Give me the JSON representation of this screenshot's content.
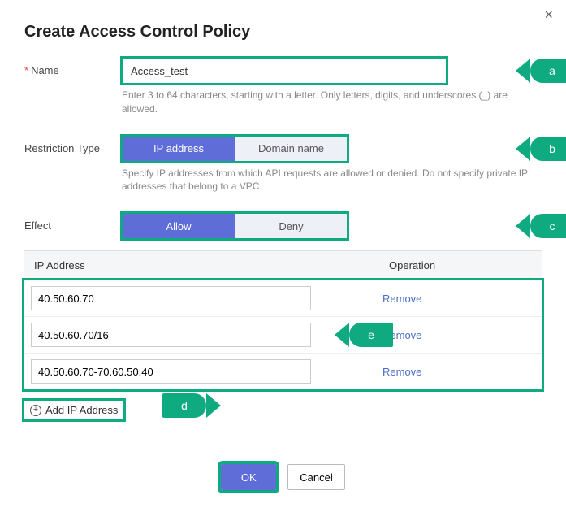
{
  "close_icon": "×",
  "title": "Create Access Control Policy",
  "name": {
    "label": "Name",
    "required": "*",
    "value": "Access_test",
    "hint": "Enter 3 to 64 characters, starting with a letter. Only letters, digits, and underscores (_) are allowed."
  },
  "restriction": {
    "label": "Restriction Type",
    "options": [
      "IP address",
      "Domain name"
    ],
    "selected_index": 0,
    "hint": "Specify IP addresses from which API requests are allowed or denied. Do not specify private IP addresses that belong to a VPC."
  },
  "effect": {
    "label": "Effect",
    "options": [
      "Allow",
      "Deny"
    ],
    "selected_index": 0
  },
  "table": {
    "headers": {
      "ip": "IP Address",
      "op": "Operation"
    },
    "rows": [
      {
        "value": "40.50.60.70",
        "op": "Remove"
      },
      {
        "value": "40.50.60.70/16",
        "op": "Remove"
      },
      {
        "value": "40.50.60.70-70.60.50.40",
        "op": "Remove"
      }
    ],
    "add_label": "Add IP Address"
  },
  "callouts": {
    "a": "a",
    "b": "b",
    "c": "c",
    "d": "d",
    "e": "e"
  },
  "footer": {
    "ok": "OK",
    "cancel": "Cancel"
  }
}
